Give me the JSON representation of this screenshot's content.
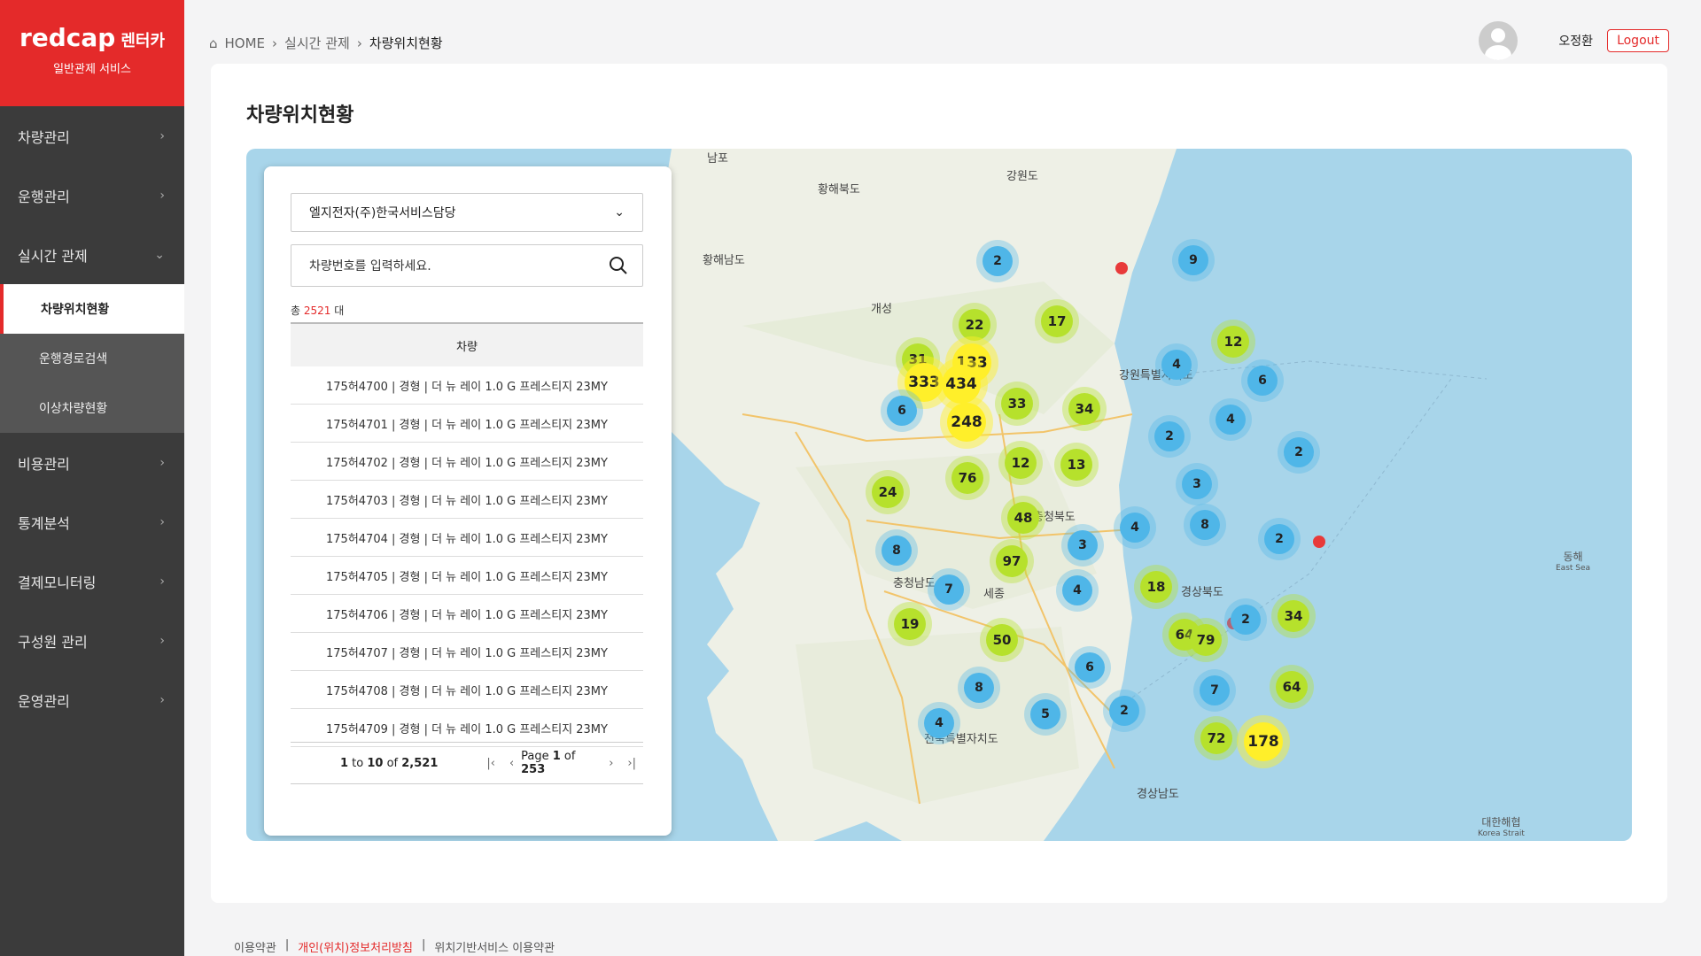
{
  "brand": {
    "name": "redcap",
    "name_kr": "렌터카",
    "subtitle": "일반관제 서비스"
  },
  "sidebar": {
    "items": [
      {
        "label": "차량관리"
      },
      {
        "label": "운행관리"
      },
      {
        "label": "실시간 관제"
      },
      {
        "label": "비용관리"
      },
      {
        "label": "통계분석"
      },
      {
        "label": "결제모니터링"
      },
      {
        "label": "구성원 관리"
      },
      {
        "label": "운영관리"
      }
    ],
    "sub_items": [
      {
        "label": "차량위치현황"
      },
      {
        "label": "운행경로검색"
      },
      {
        "label": "이상차량현황"
      }
    ]
  },
  "breadcrumb": {
    "home": "HOME",
    "section": "실시간 관제",
    "current": "차량위치현황"
  },
  "user": {
    "name": "오정환",
    "logout": "Logout"
  },
  "page": {
    "title": "차량위치현황"
  },
  "panel": {
    "company": "엘지전자(주)한국서비스담당",
    "search_placeholder": "차량번호를 입력하세요.",
    "total_prefix": "총",
    "total_count": "2521",
    "total_suffix": "대",
    "column": "차량",
    "rows": [
      "175허4700 | 경형 | 더 뉴 레이 1.0 G 프레스티지 23MY",
      "175허4701 | 경형 | 더 뉴 레이 1.0 G 프레스티지 23MY",
      "175허4702 | 경형 | 더 뉴 레이 1.0 G 프레스티지 23MY",
      "175허4703 | 경형 | 더 뉴 레이 1.0 G 프레스티지 23MY",
      "175허4704 | 경형 | 더 뉴 레이 1.0 G 프레스티지 23MY",
      "175허4705 | 경형 | 더 뉴 레이 1.0 G 프레스티지 23MY",
      "175허4706 | 경형 | 더 뉴 레이 1.0 G 프레스티지 23MY",
      "175허4707 | 경형 | 더 뉴 레이 1.0 G 프레스티지 23MY",
      "175허4708 | 경형 | 더 뉴 레이 1.0 G 프레스티지 23MY",
      "175허4709 | 경형 | 더 뉴 레이 1.0 G 프레스티지 23MY"
    ],
    "pager": {
      "from": "1",
      "to": "10",
      "total": "2,521",
      "page": "1",
      "pages": "253"
    }
  },
  "map": {
    "places": [
      "남포",
      "황해북도",
      "강원도",
      "황해남도",
      "개성",
      "강원특별자치도",
      "충청북도",
      "충청남도",
      "세종",
      "경상북도",
      "전북특별자치도",
      "경상남도",
      "동해",
      "East Sea",
      "대한해협",
      "Korea Strait"
    ],
    "clusters": [
      "2",
      "9",
      "22",
      "17",
      "12",
      "31",
      "133",
      "333",
      "434",
      "4",
      "6",
      "33",
      "248",
      "34",
      "4",
      "2",
      "2",
      "6",
      "12",
      "13",
      "76",
      "24",
      "3",
      "48",
      "4",
      "8",
      "8",
      "3",
      "97",
      "2",
      "18",
      "7",
      "4",
      "34",
      "19",
      "50",
      "64",
      "79",
      "2",
      "6",
      "8",
      "7",
      "64",
      "4",
      "5",
      "2",
      "72",
      "178"
    ]
  },
  "footer": {
    "terms": "이용약관",
    "privacy": "개인(위치)정보처리방침",
    "location_terms": "위치기반서비스 이용약관"
  }
}
